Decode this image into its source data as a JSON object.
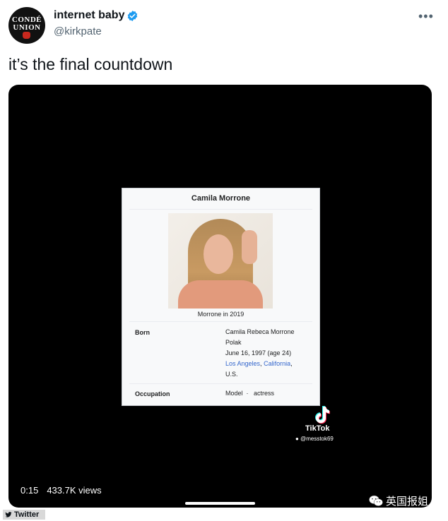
{
  "account": {
    "avatar_line1": "CONDÉ",
    "avatar_line2": "UNION",
    "display_name": "internet baby",
    "handle": "@kirkpate",
    "verified_color": "#1d9bf0",
    "more_icon": "more-horizontal-icon"
  },
  "tweet": {
    "text": "it’s the final countdown"
  },
  "wiki_card": {
    "title": "Camila Morrone",
    "image_caption": "Morrone in 2019",
    "born_label": "Born",
    "born_name_line1": "Camila Rebeca Morrone",
    "born_name_line2": "Polak",
    "born_date": "June 16, 1997 (age 24)",
    "born_city": "Los Angeles",
    "born_comma1": ",",
    "born_state": "California",
    "born_comma2": ",",
    "born_country": "U.S.",
    "occupation_label": "Occupation",
    "occupation_value1": "Model",
    "occupation_sep": "·",
    "occupation_value2": "actress",
    "link_color": "#3366cc"
  },
  "video": {
    "tiktok_label": "TikTok",
    "tiktok_user": "@messtok69",
    "time": "0:15",
    "views": "433.7K views"
  },
  "footer": {
    "credit": "Twitter",
    "watermark": "英国报姐"
  }
}
